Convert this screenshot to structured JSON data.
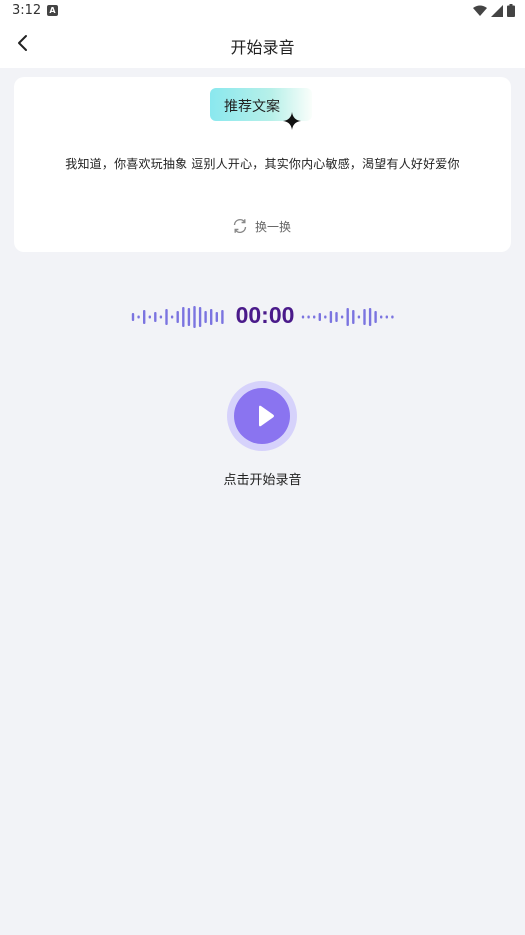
{
  "status_bar": {
    "time": "3:12",
    "notification_icon": "A"
  },
  "header": {
    "title": "开始录音"
  },
  "card": {
    "tag": "推荐文案",
    "quote": "我知道，你喜欢玩抽象 逗别人开心，其实你内心敏感，渴望有人好好爱你",
    "refresh_label": "换一换"
  },
  "recorder": {
    "timer": "00:00",
    "start_label": "点击开始录音"
  },
  "colors": {
    "accent": "#8a74f0",
    "accent_ring": "#d6d2fb",
    "timer": "#4a1a8a",
    "wave": "#7b74e0",
    "background": "#f2f3f7"
  }
}
